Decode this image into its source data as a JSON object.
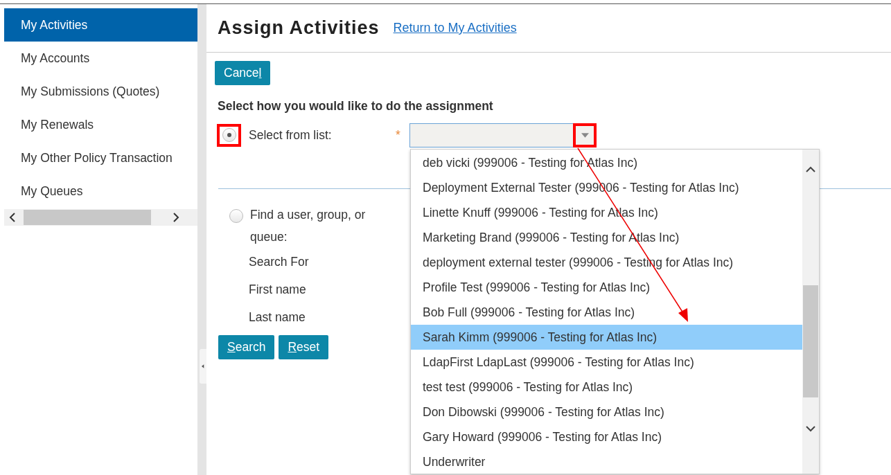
{
  "sidebar": {
    "items": [
      {
        "label": "My Activities",
        "selected": true
      },
      {
        "label": "My Accounts",
        "selected": false
      },
      {
        "label": "My Submissions (Quotes)",
        "selected": false
      },
      {
        "label": "My Renewals",
        "selected": false
      },
      {
        "label": "My Other Policy Transaction",
        "selected": false
      },
      {
        "label": "My Queues",
        "selected": false
      }
    ]
  },
  "title": "Assign Activities",
  "return_link": "Return to My Activities",
  "cancel_button": {
    "before": "Cance",
    "key": "l"
  },
  "heading": "Select how you would like to do the assignment",
  "options": [
    {
      "label": "Select from list:",
      "selected": true,
      "highlighted": true,
      "kind": "list"
    },
    {
      "label": "Find a user, group, or queue:",
      "selected": false,
      "highlighted": false,
      "kind": "search"
    }
  ],
  "dropdown": {
    "required_mark": "*",
    "arrow_highlighted": true,
    "pointer_arrow": true,
    "items": [
      {
        "label": "deb vicki (999006 - Testing for Atlas Inc)",
        "selected": false
      },
      {
        "label": "Deployment External Tester (999006 - Testing for Atlas Inc)",
        "selected": false
      },
      {
        "label": "Linette Knuff (999006 - Testing for Atlas Inc)",
        "selected": false
      },
      {
        "label": "Marketing Brand (999006 - Testing for Atlas Inc)",
        "selected": false
      },
      {
        "label": "deployment external tester (999006 - Testing for Atlas Inc)",
        "selected": false
      },
      {
        "label": "Profile Test (999006 - Testing for Atlas Inc)",
        "selected": false
      },
      {
        "label": "Bob Full (999006 - Testing for Atlas Inc)",
        "selected": false
      },
      {
        "label": "Sarah Kimm (999006 - Testing for Atlas Inc)",
        "selected": true
      },
      {
        "label": "LdapFirst LdapLast (999006 - Testing for Atlas Inc)",
        "selected": false
      },
      {
        "label": "test test (999006 - Testing for Atlas Inc)",
        "selected": false
      },
      {
        "label": "Don Dibowski (999006 - Testing for Atlas Inc)",
        "selected": false
      },
      {
        "label": "Gary Howard (999006 - Testing for Atlas Inc)",
        "selected": false
      },
      {
        "label": "Underwriter",
        "selected": false
      }
    ]
  },
  "search_fields": [
    "Search For",
    "First name",
    "Last name"
  ],
  "buttons": [
    {
      "key": "S",
      "after": "earch"
    },
    {
      "key": "R",
      "after": "eset"
    }
  ]
}
